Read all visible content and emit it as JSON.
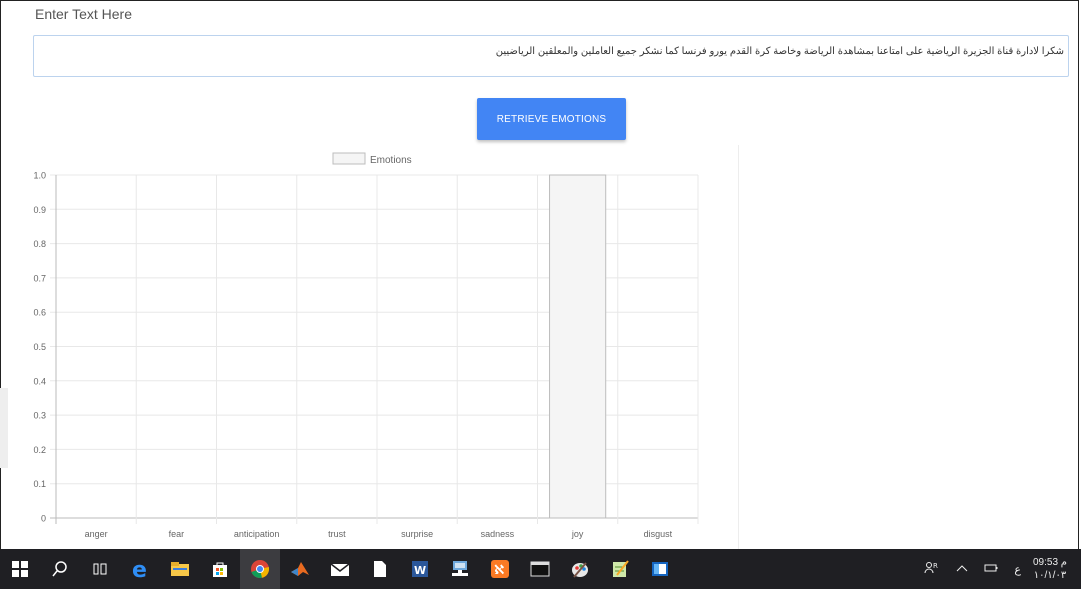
{
  "input": {
    "label": "Enter Text Here",
    "value": "شكرا لادارة قناة الجزيرة الرياضية على امتاعنا بمشاهدة الرياضة وخاصة كرة القدم يورو فرنسا كما نشكر جميع العاملين والمعلقين الرياضيين"
  },
  "button": {
    "label": "RETRIEVE EMOTIONS"
  },
  "chart_data": {
    "type": "bar",
    "legend": {
      "label": "Emotions",
      "position": "top"
    },
    "categories": [
      "anger",
      "fear",
      "anticipation",
      "trust",
      "surprise",
      "sadness",
      "joy",
      "disgust"
    ],
    "series": [
      {
        "name": "Emotions",
        "values": [
          0,
          0,
          0,
          0,
          0,
          0,
          1.0,
          0
        ]
      }
    ],
    "ylim": [
      0,
      1.0
    ],
    "yticks": [
      "0",
      "0.1",
      "0.2",
      "0.3",
      "0.4",
      "0.5",
      "0.6",
      "0.7",
      "0.8",
      "0.9",
      "1.0"
    ],
    "grid": true,
    "bar_fill": "#f5f5f5",
    "bar_stroke": "#bdbdbd"
  },
  "taskbar": {
    "icons": [
      "windows-start-icon",
      "search-icon",
      "task-view-icon",
      "edge-icon",
      "file-explorer-icon",
      "store-icon",
      "chrome-icon",
      "matlab-icon",
      "mail-icon",
      "document-icon",
      "word-icon",
      "network-app-icon",
      "xampp-icon",
      "terminal-icon",
      "paint-icon",
      "notepad-icon",
      "app-icon"
    ],
    "tray": {
      "language": "ع",
      "time": "09:53 م",
      "date": "١٠/١/٠٣"
    }
  }
}
